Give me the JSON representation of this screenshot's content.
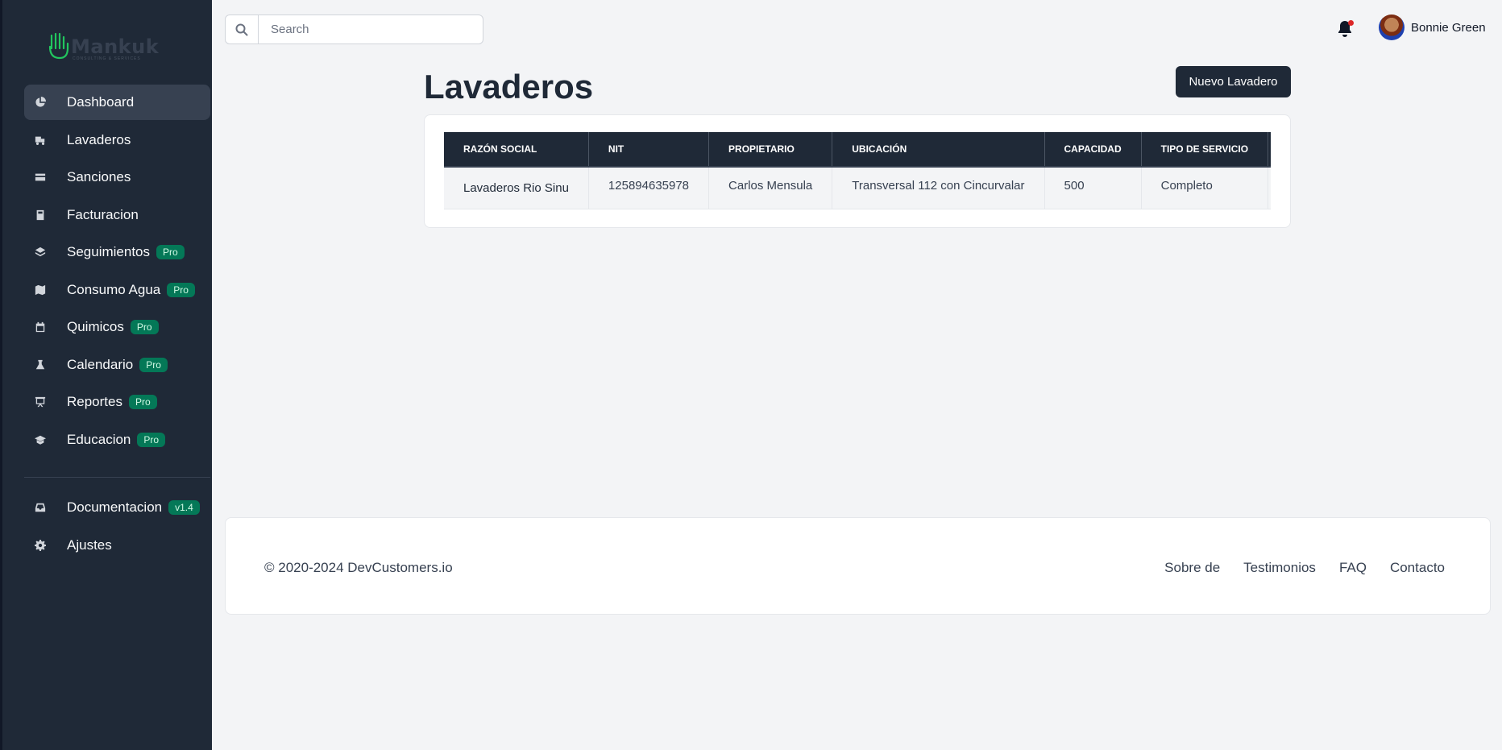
{
  "brand": {
    "name": "Mankuk",
    "tagline": "CONSULTING & SERVICES"
  },
  "search": {
    "placeholder": "Search"
  },
  "user": {
    "name": "Bonnie Green"
  },
  "sidebar": {
    "items": [
      {
        "label": "Dashboard",
        "icon": "chart-pie-icon"
      },
      {
        "label": "Lavaderos",
        "icon": "truck-icon"
      },
      {
        "label": "Sanciones",
        "icon": "credit-card-icon"
      },
      {
        "label": "Facturacion",
        "icon": "calculator-icon"
      },
      {
        "label": "Seguimientos",
        "icon": "layers-icon",
        "badge": "Pro"
      },
      {
        "label": "Consumo Agua",
        "icon": "map-icon",
        "badge": "Pro"
      },
      {
        "label": "Quimicos",
        "icon": "calendar-icon",
        "badge": "Pro"
      },
      {
        "label": "Calendario",
        "icon": "flask-icon",
        "badge": "Pro"
      },
      {
        "label": "Reportes",
        "icon": "presentation-chart-icon",
        "badge": "Pro"
      },
      {
        "label": "Educacion",
        "icon": "academic-cap-icon",
        "badge": "Pro"
      }
    ],
    "secondary": [
      {
        "label": "Documentacion",
        "icon": "inbox-icon",
        "badge": "v1.4"
      },
      {
        "label": "Ajustes",
        "icon": "cog-icon"
      }
    ]
  },
  "main": {
    "title": "Lavaderos",
    "new_button": "Nuevo Lavadero",
    "table": {
      "headers": [
        "RAZÓN SOCIAL",
        "NIT",
        "PROPIETARIO",
        "UBICACIÓN",
        "CAPACIDAD",
        "TIPO DE SERVICIO"
      ],
      "rows": [
        [
          "Lavaderos Rio Sinu",
          "125894635978",
          "Carlos Mensula",
          "Transversal 112 con Cincurvalar",
          "500",
          "Completo"
        ]
      ]
    }
  },
  "footer": {
    "copyright": "© 2020-2024 DevCustomers.io",
    "links": [
      "Sobre de",
      "Testimonios",
      "FAQ",
      "Contacto"
    ]
  },
  "colors": {
    "sidebar_bg": "#1f2937",
    "accent": "#047857",
    "notification": "#dc2626"
  }
}
